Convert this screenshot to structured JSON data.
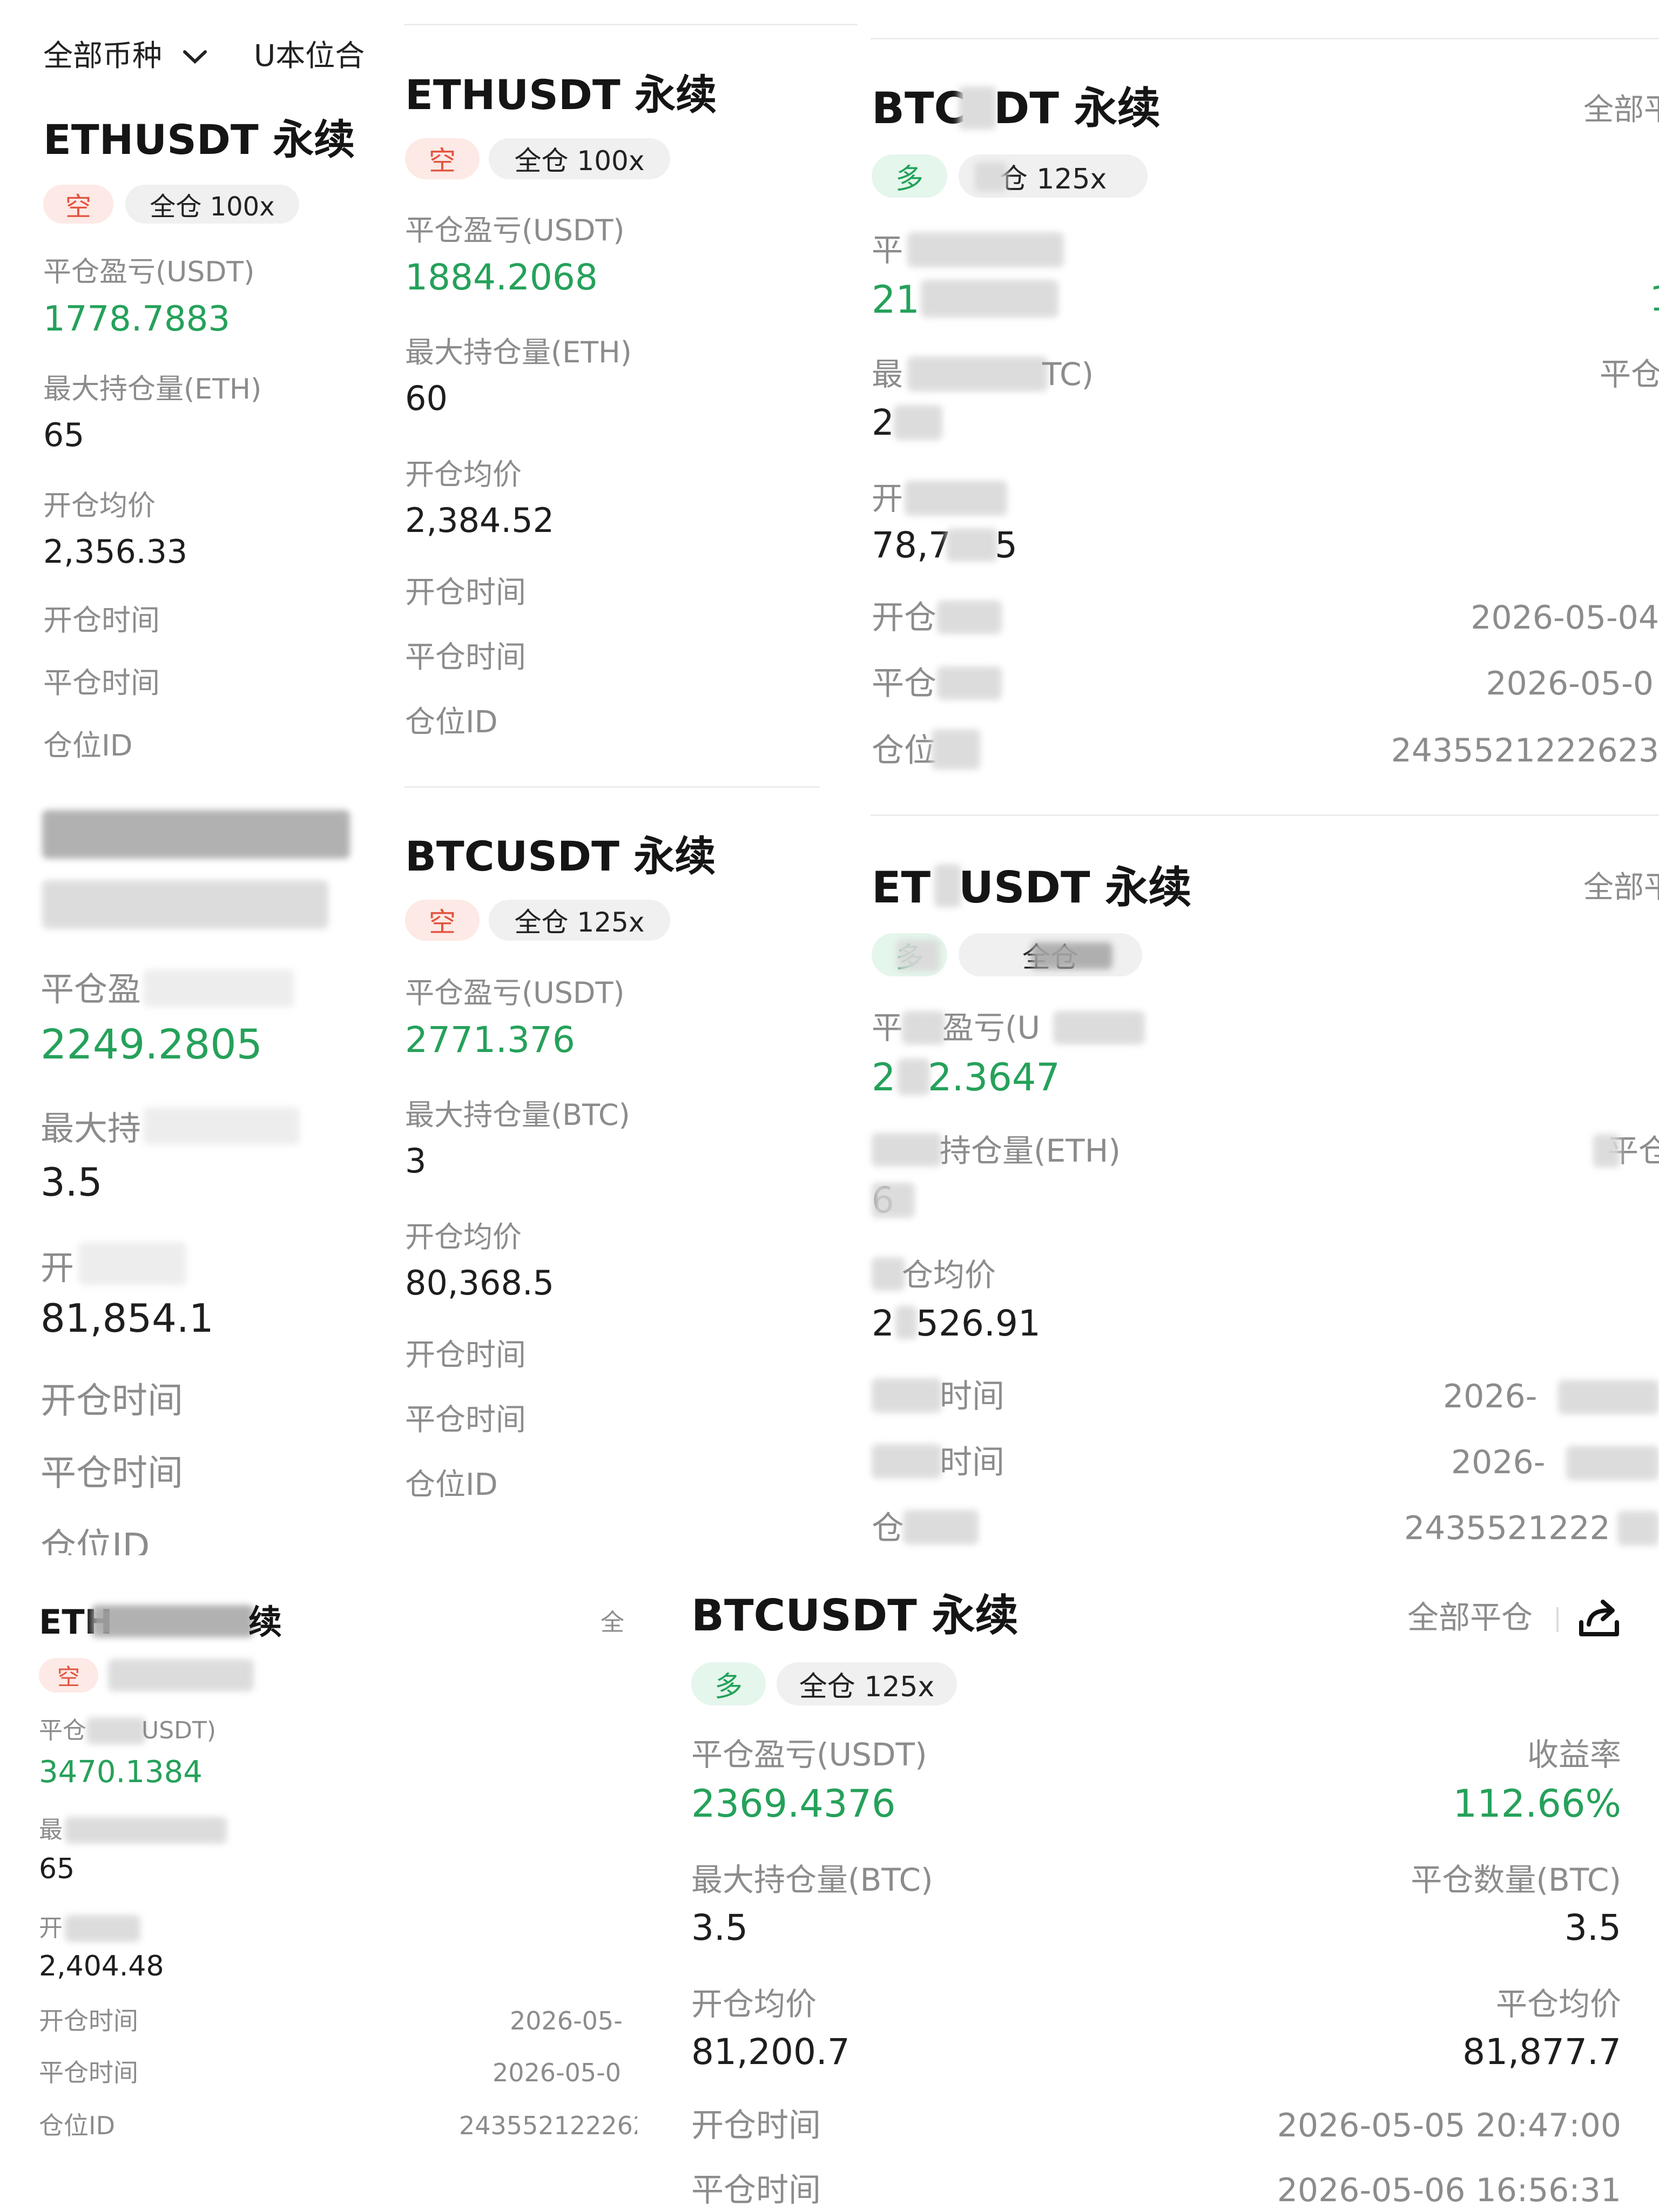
{
  "filter": {
    "all_coins": "全部币种",
    "u_position": "U本位合"
  },
  "panel_a": {
    "card1": {
      "title": "ETHUSDT 永续",
      "side": "空",
      "mode": "全仓 100x",
      "pnl_label": "平仓盈亏(USDT)",
      "pnl": "1778.7883",
      "max_label": "最大持仓量(ETH)",
      "max": "65",
      "avg_label": "开仓均价",
      "avg": "2,356.33",
      "open_time_label": "开仓时间",
      "close_time_label": "平仓时间",
      "id_label": "仓位ID"
    },
    "card2": {
      "pnl_label": "平仓盈",
      "pnl": "2249.2805",
      "max_label": "最大持",
      "max": "3.5",
      "avg_label": "开",
      "avg": "81,854.1",
      "open_time_label": "开仓时间",
      "close_time_label": "平仓时间",
      "id_label": "仓位ID"
    }
  },
  "panel_b": {
    "card1": {
      "title": "ETHUSDT 永续",
      "side": "空",
      "mode": "全仓 100x",
      "pnl_label": "平仓盈亏(USDT)",
      "pnl": "1884.2068",
      "max_label": "最大持仓量(ETH)",
      "max": "60",
      "avg_label": "开仓均价",
      "avg": "2,384.52",
      "open_time_label": "开仓时间",
      "close_time_label": "平仓时间",
      "id_label": "仓位ID"
    },
    "card2": {
      "title": "BTCUSDT 永续",
      "side": "空",
      "mode": "全仓 125x",
      "pnl_label": "平仓盈亏(USDT)",
      "pnl": "2771.376",
      "max_label": "最大持仓量(BTC)",
      "max": "3",
      "avg_label": "开仓均价",
      "avg": "80,368.5",
      "open_time_label": "开仓时间",
      "close_time_label": "平仓时间",
      "id_label": "仓位ID"
    }
  },
  "panel_c": {
    "card1": {
      "title_a": "BTC",
      "title_b": "DT 永续",
      "side": "多",
      "mode": "仓 125x",
      "pnl_label": "平",
      "pnl": "21",
      "max_label": "最",
      "max_unit": "TC)",
      "max": "2",
      "avg_label": "开",
      "avg_a": "78,7",
      "avg_b": "5",
      "open_time_label": "开仓",
      "open_time": "2026-05-04",
      "close_time_label": "平仓",
      "close_time": "2026-05-0",
      "id_label": "仓位",
      "id": "2435521222623",
      "right_header": "全部平",
      "right_label": "平仓",
      "right_val": "1"
    },
    "card2": {
      "title_a": "ET",
      "title_b": "USDT 永续",
      "side": "多",
      "mode": "全仓",
      "pnl_label": "平",
      "pnl_label_b": "盈亏(U",
      "pnl_a": "2",
      "pnl_b": "2.3647",
      "max_label": "持仓量(ETH)",
      "max": "6",
      "avg_label": "仓均价",
      "avg_a": "2",
      "avg_b": "526.91",
      "open_time_label": "时间",
      "open_time": "2026-",
      "close_time_label": "时间",
      "close_time": "2026-",
      "id_label": "仓",
      "id": "2435521222",
      "right_header": "全部平",
      "right_label": "平仓"
    }
  },
  "panel_d": {
    "title": "ETH",
    "title_end": "续",
    "side": "空",
    "pnl_label": "平仓",
    "pnl_unit": "USDT)",
    "pnl": "3470.1384",
    "max_label": "最",
    "max": "65",
    "avg_label": "开",
    "avg": "2,404.48",
    "open_time_label": "开仓时间",
    "open_time": "2026-05-",
    "close_time_label": "平仓时间",
    "close_time": "2026-05-0",
    "id_label": "仓位ID",
    "id": "243552122262",
    "right_header": "全"
  },
  "panel_e": {
    "title": "BTCUSDT 永续",
    "close_all": "全部平仓",
    "side": "多",
    "mode": "全仓 125x",
    "pnl_label": "平仓盈亏(USDT)",
    "pnl": "2369.4376",
    "roi_label": "收益率",
    "roi": "112.66%",
    "max_label": "最大持仓量(BTC)",
    "max": "3.5",
    "close_qty_label": "平仓数量(BTC)",
    "close_qty": "3.5",
    "avg_label": "开仓均价",
    "avg": "81,200.7",
    "close_avg_label": "平仓均价",
    "close_avg": "81,877.7",
    "open_time_label": "开仓时间",
    "open_time": "2026-05-05 20:47:00",
    "close_time_label": "平仓时间",
    "close_time": "2026-05-06 16:56:31"
  },
  "colors": {
    "profit": "#25a15a",
    "short": "#e2543f",
    "long": "#23a25a"
  },
  "icons": [
    "chevron-down-icon",
    "share-icon"
  ]
}
